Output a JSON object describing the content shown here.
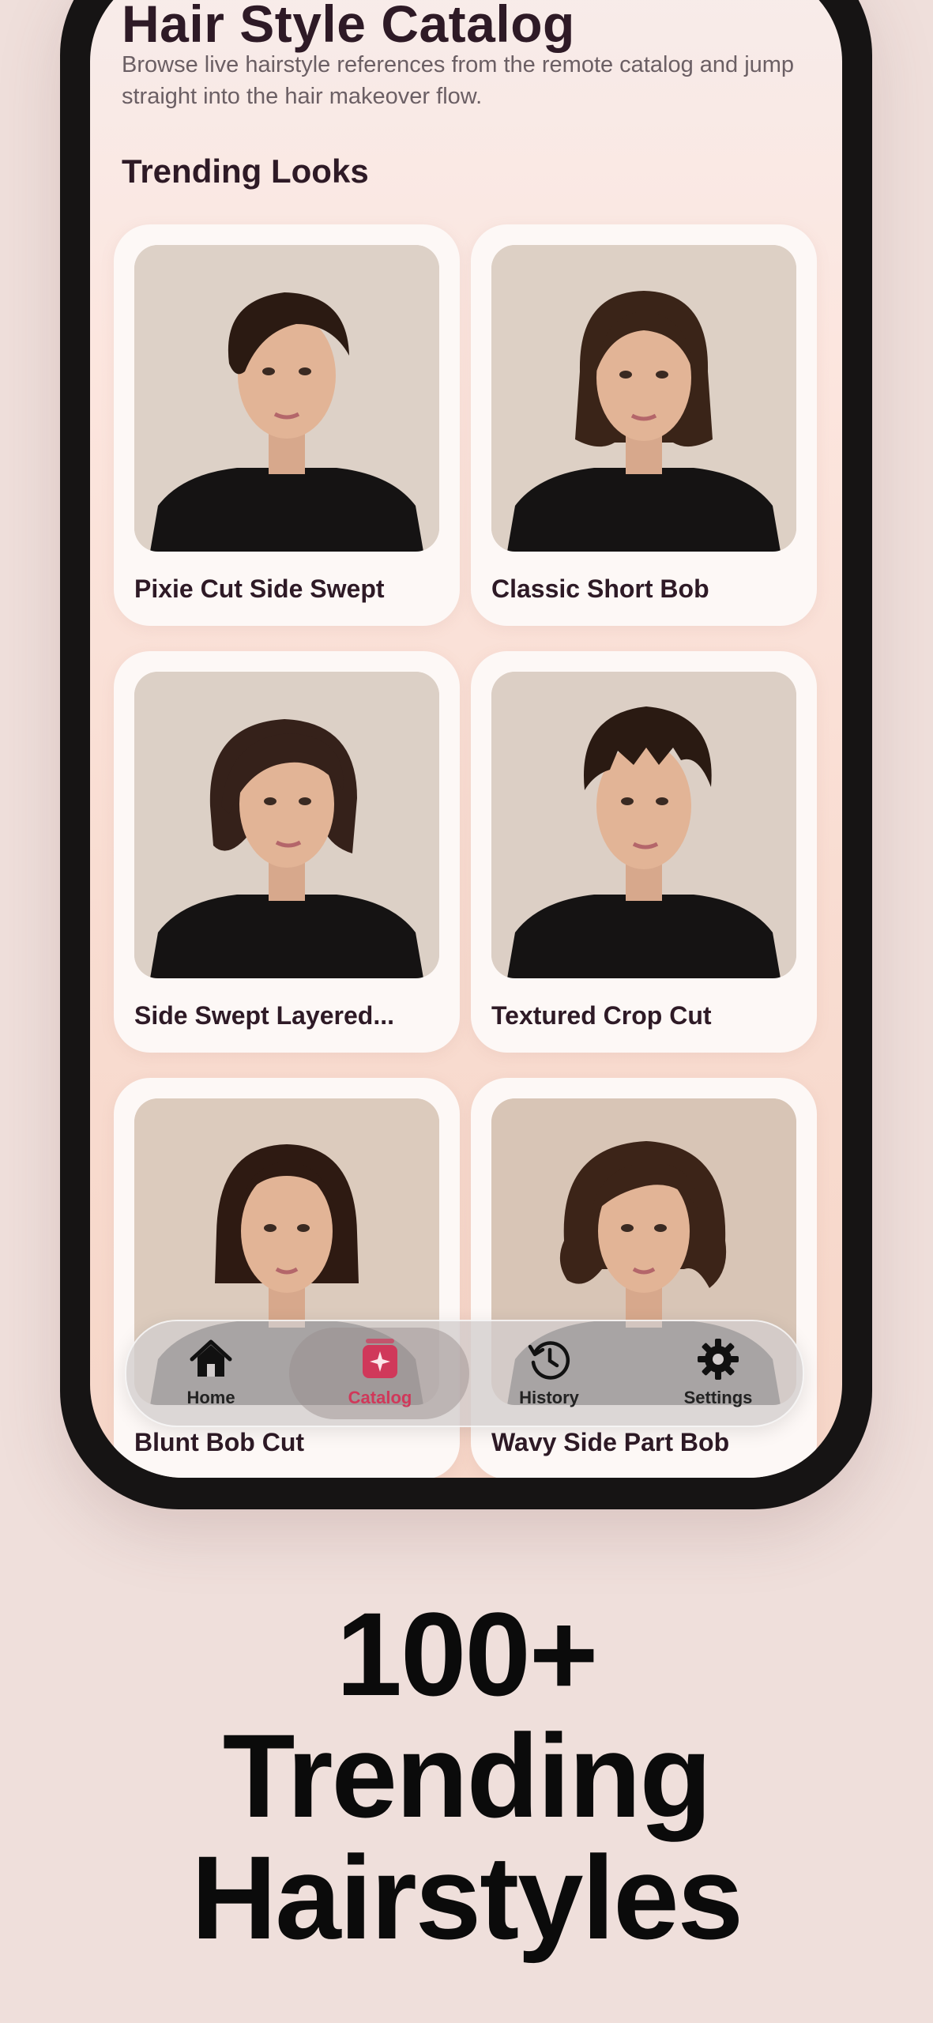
{
  "page": {
    "title": "Hair Style Catalog",
    "subtitle": "Browse live hairstyle references from the remote catalog and jump straight into the hair makeover flow.",
    "section_title": "Trending Looks"
  },
  "cards": [
    {
      "label": "Pixie Cut Side Swept",
      "image": "pixie-cut-side-swept-photo"
    },
    {
      "label": "Classic Short Bob",
      "image": "classic-short-bob-photo"
    },
    {
      "label": "Side Swept Layered...",
      "image": "side-swept-layered-photo"
    },
    {
      "label": "Textured Crop Cut",
      "image": "textured-crop-cut-photo"
    },
    {
      "label": "Blunt Bob Cut",
      "image": "blunt-bob-cut-photo"
    },
    {
      "label": "Wavy Side Part Bob",
      "image": "wavy-side-part-bob-photo"
    }
  ],
  "tabbar": {
    "items": [
      {
        "label": "Home",
        "icon": "house-icon"
      },
      {
        "label": "Catalog",
        "icon": "catalog-sparkle-icon",
        "active": true
      },
      {
        "label": "History",
        "icon": "history-clock-icon"
      },
      {
        "label": "Settings",
        "icon": "gear-icon"
      }
    ]
  },
  "headline": {
    "line1": "100+",
    "line2": "Trending",
    "line3": "Hairstyles"
  },
  "colors": {
    "accent": "#d0385a",
    "title": "#2e1a26",
    "background": "#efdfdb"
  }
}
